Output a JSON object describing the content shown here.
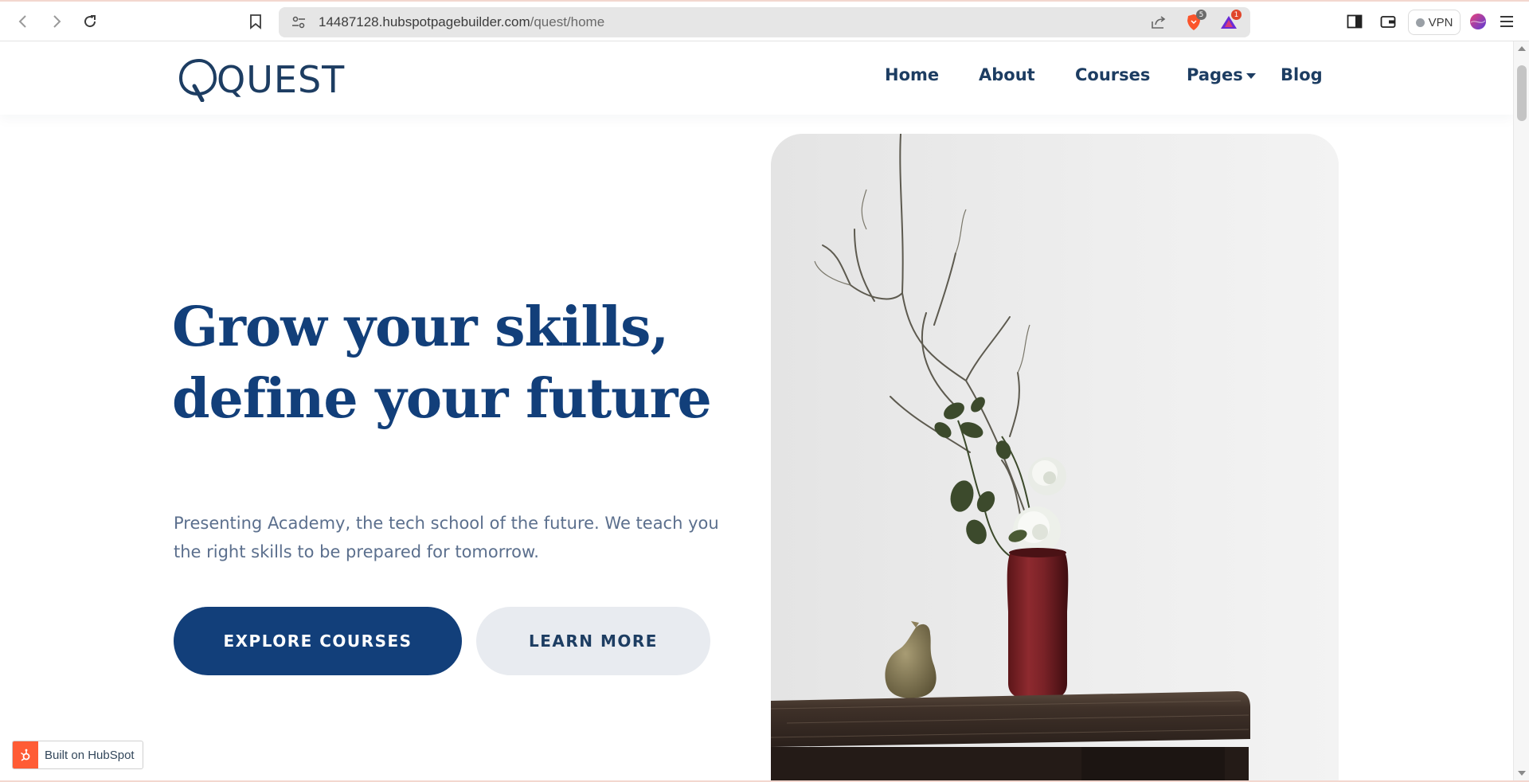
{
  "browser": {
    "url_host": "14487128.hubspotpagebuilder.com",
    "url_path": "/quest/home",
    "brave_badge": "5",
    "rewards_badge": "1",
    "vpn_label": "VPN",
    "icons": [
      "back-icon",
      "forward-icon",
      "reload-icon",
      "bookmark-icon",
      "site-settings-icon",
      "share-icon",
      "brave-shields-icon",
      "brave-rewards-icon",
      "sidebar-icon",
      "wallet-icon",
      "profile-icon",
      "menu-icon"
    ]
  },
  "header": {
    "logo_text": "QUEST",
    "nav": {
      "home": "Home",
      "about": "About",
      "courses": "Courses",
      "pages": "Pages",
      "blog": "Blog"
    }
  },
  "hero": {
    "title_line1": "Grow your skills,",
    "title_line2": "define your future",
    "subtitle": "Presenting Academy, the tech school of the future. We teach you the right skills to be prepared for tomorrow.",
    "primary_button": "EXPLORE COURSES",
    "secondary_button": "LEARN MORE"
  },
  "badge": {
    "label": "Built on HubSpot"
  },
  "colors": {
    "brand_navy": "#123f7a",
    "nav_text": "#1d3d62",
    "subtitle_text": "#5b6f8d",
    "secondary_button_bg": "#e8ebf0",
    "hubspot_orange": "#ff5c35"
  }
}
